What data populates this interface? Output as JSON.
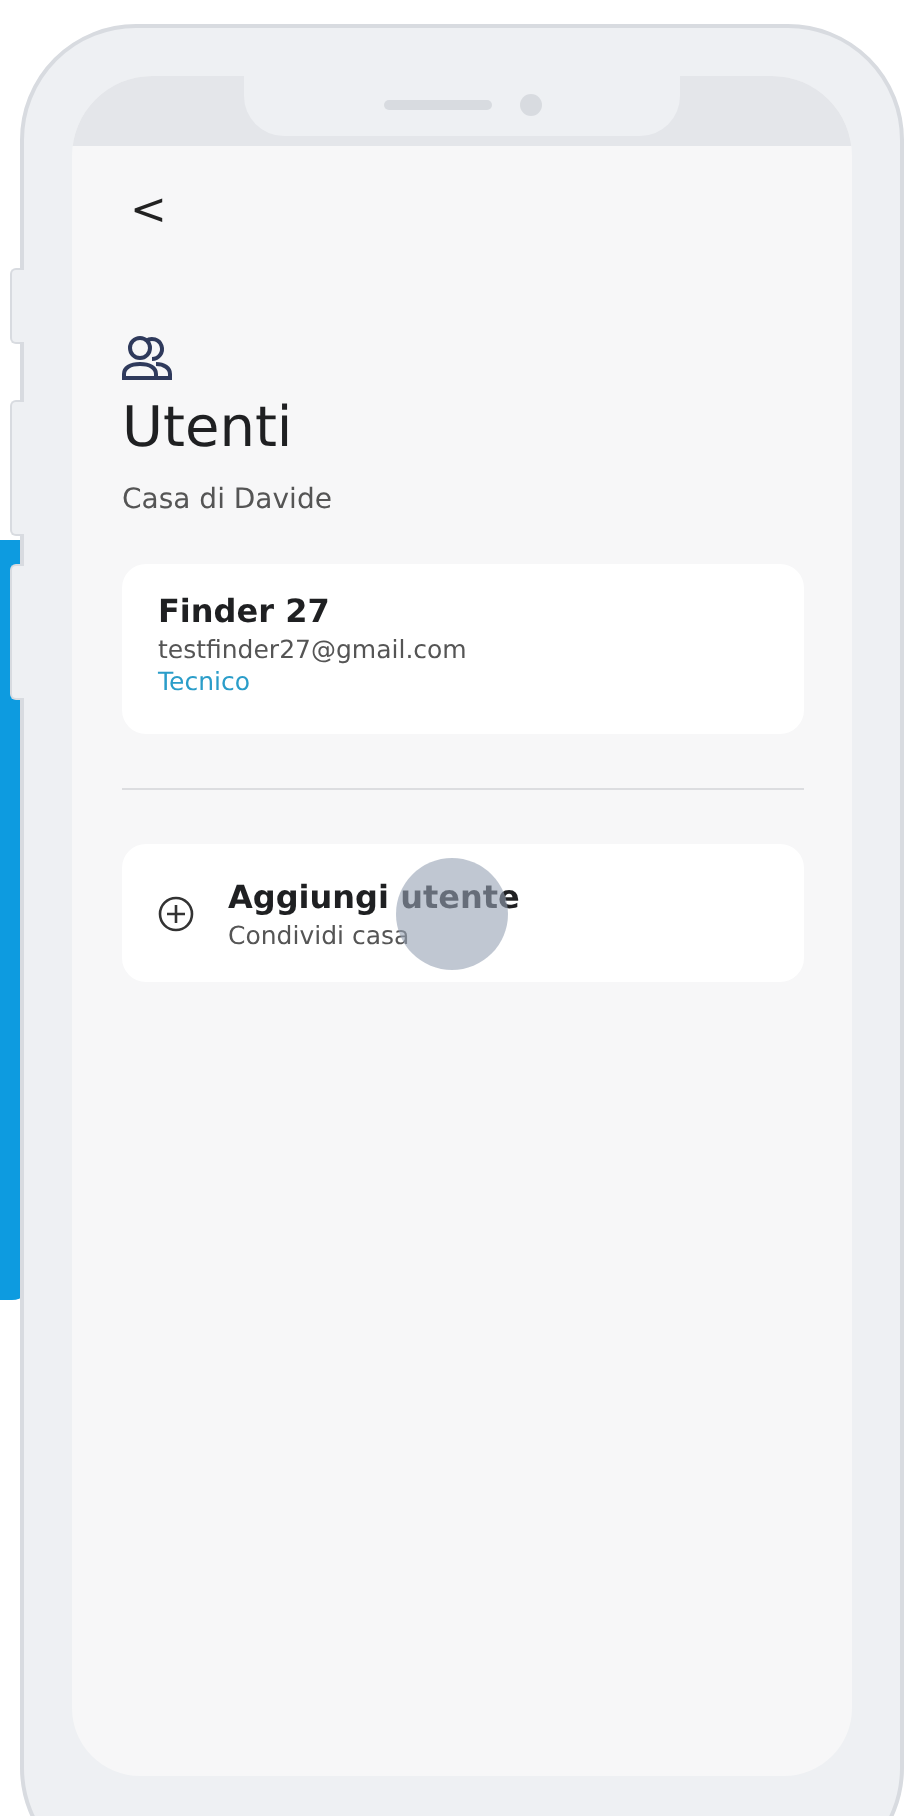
{
  "back": {
    "label": "<"
  },
  "header": {
    "title": "Utenti",
    "subtitle": "Casa di Davide"
  },
  "users": [
    {
      "name": "Finder 27",
      "email": "testfinder27@gmail.com",
      "role": "Tecnico"
    }
  ],
  "add_user": {
    "title": "Aggiungi utente",
    "subtitle": "Condividi casa",
    "pressed": true
  }
}
